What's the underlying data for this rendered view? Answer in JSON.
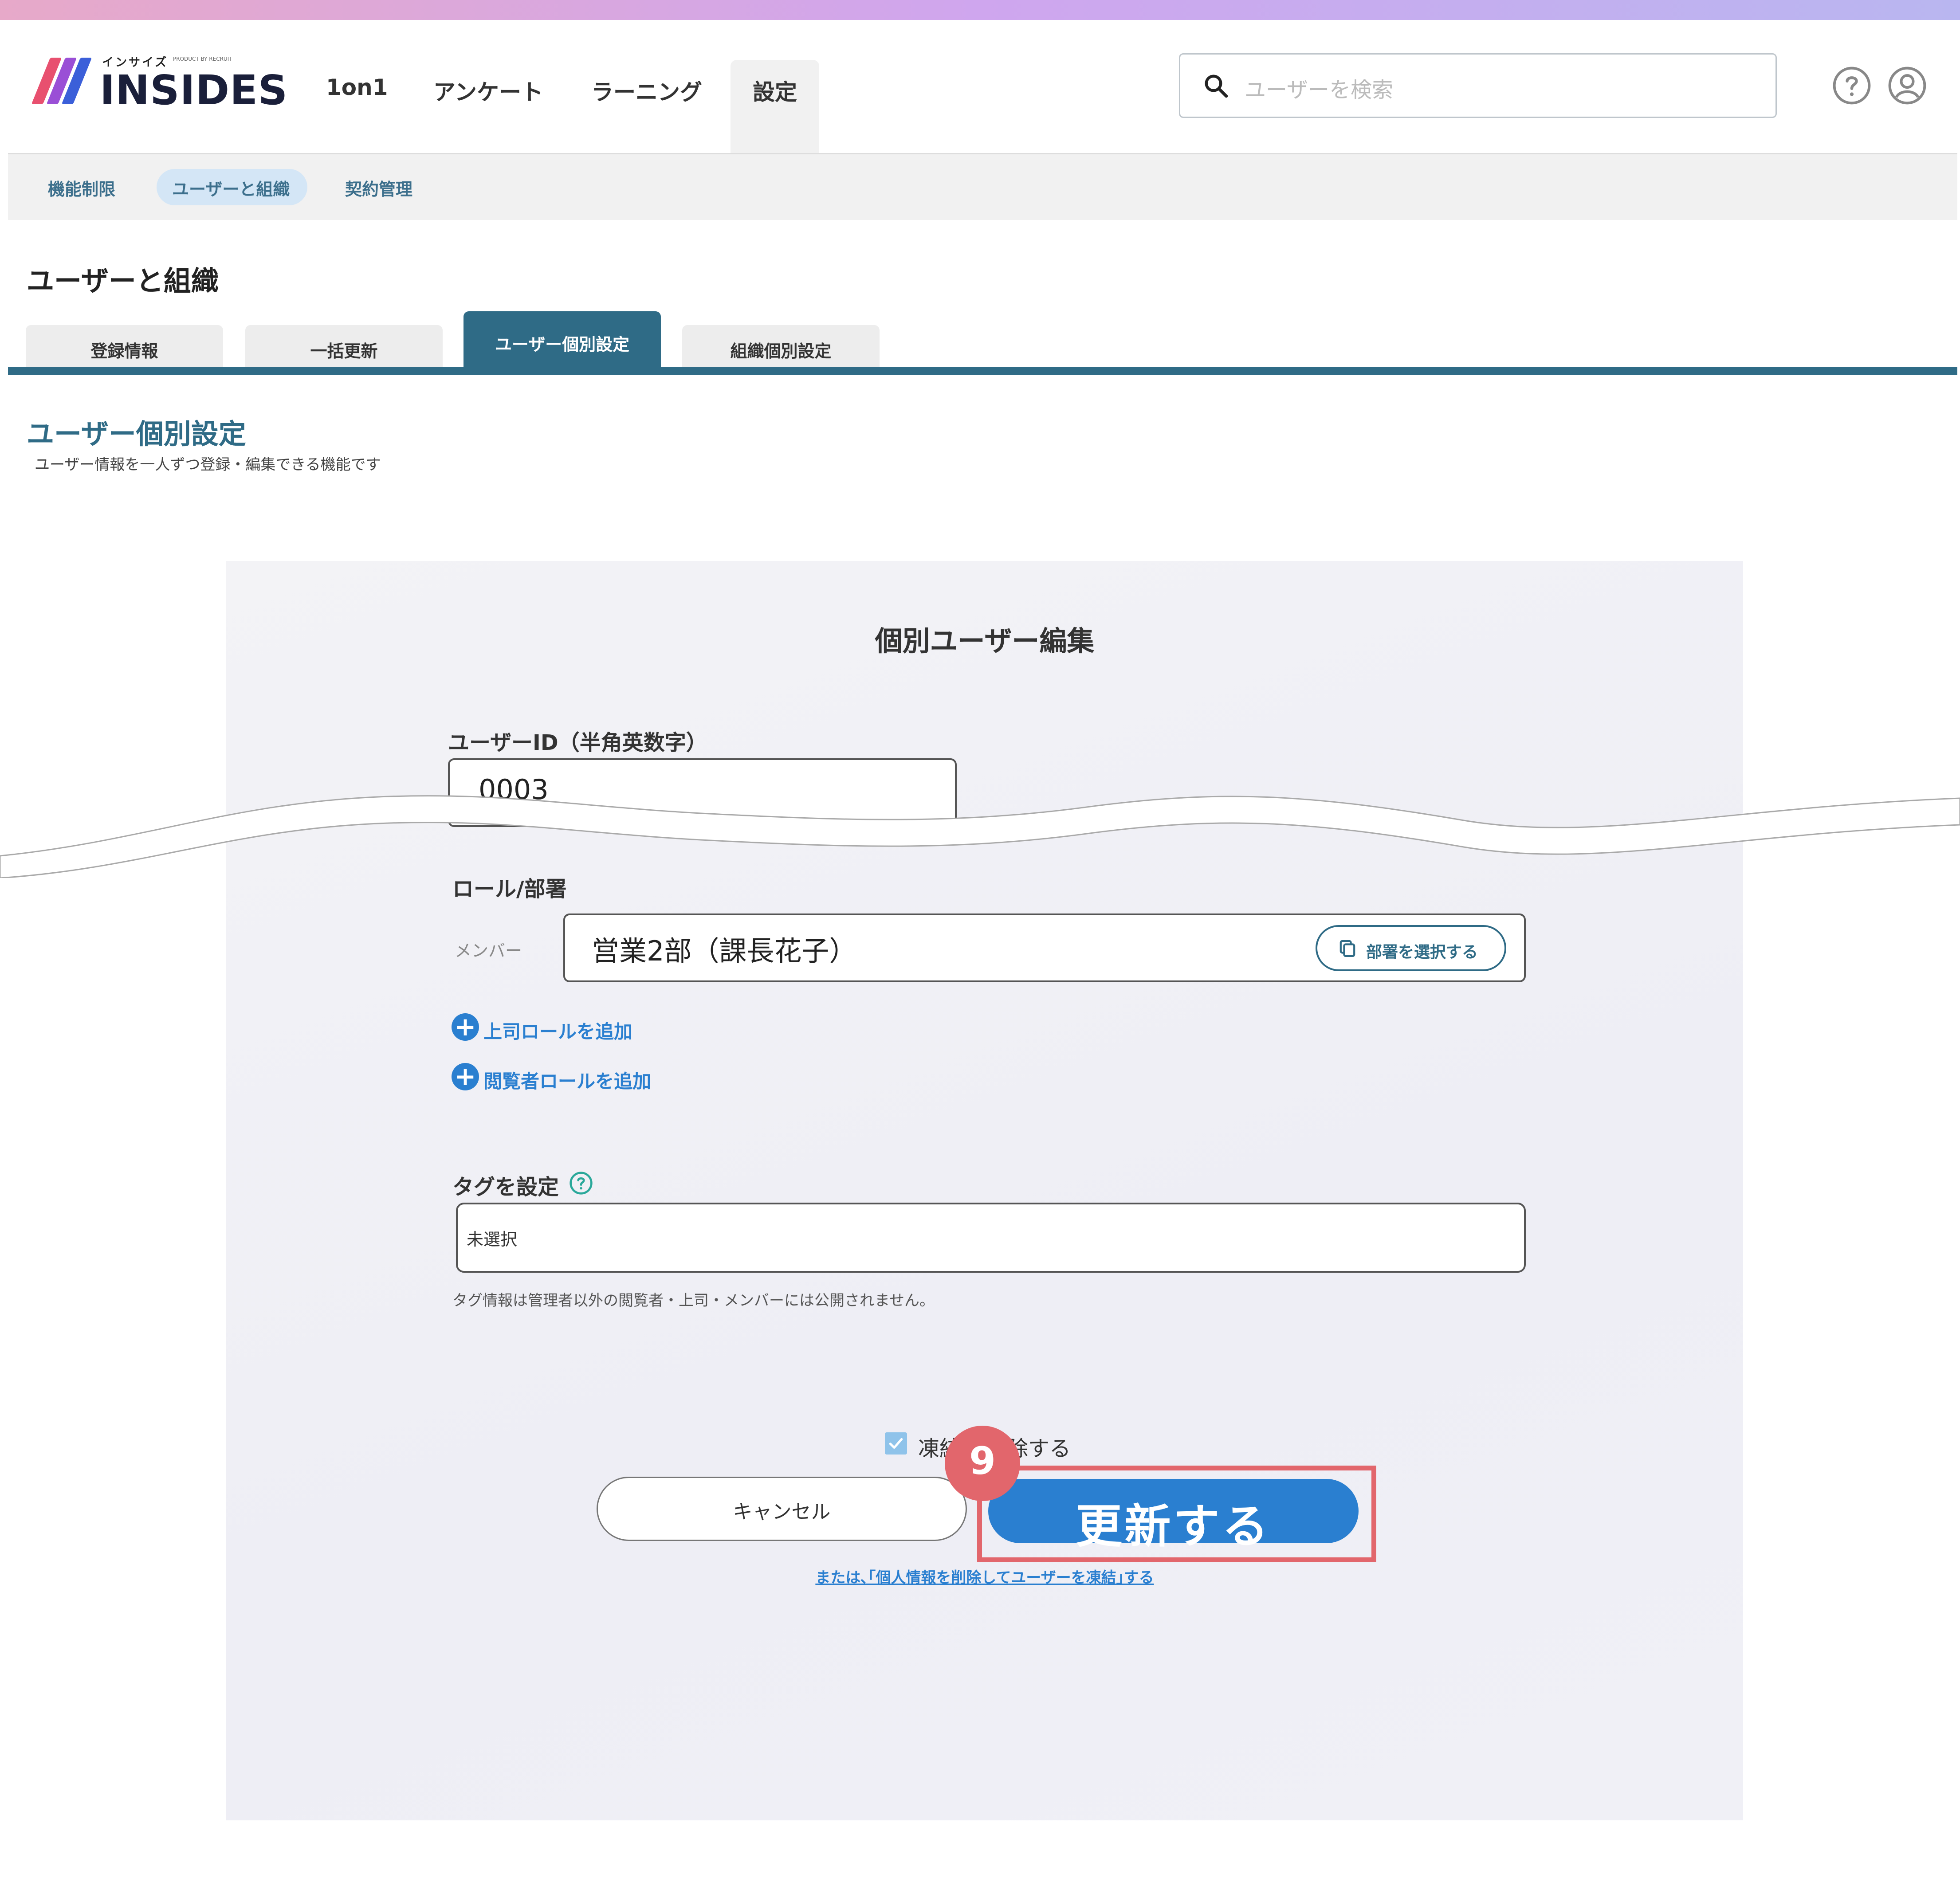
{
  "header": {
    "logo": {
      "kana": "インサイズ",
      "small": "PRODUCT BY RECRUIT",
      "word": "INSIDES"
    },
    "nav": [
      "1on1",
      "アンケート",
      "ラーニング",
      "設定"
    ],
    "search": {
      "placeholder": "ユーザーを検索"
    }
  },
  "subnav": [
    "機能制限",
    "ユーザーと組織",
    "契約管理"
  ],
  "section_title": "ユーザーと組織",
  "tabs": [
    "登録情報",
    "一括更新",
    "ユーザー個別設定",
    "組織個別設定"
  ],
  "page": {
    "heading": "ユーザー個別設定",
    "description": "ユーザー情報を一人ずつ登録・編集できる機能です"
  },
  "form": {
    "title": "個別ユーザー編集",
    "user_id_label": "ユーザーID（半角英数字）",
    "user_id_value": "0003",
    "role_label": "ロール/部署",
    "role_member_label": "メンバー",
    "role_value": "営業2部（課長花子）",
    "dept_button": "部署を選択する",
    "add_boss_role": "上司ロールを追加",
    "add_viewer_role": "閲覧者ロールを追加",
    "tag_label": "タグを設定",
    "tag_placeholder": "未選択",
    "tag_note": "タグ情報は管理者以外の閲覧者・上司・メンバーには公開されません。",
    "freeze_text_a": "凍結",
    "freeze_text_b": "除する",
    "freeze_checked": true,
    "cancel_button": "キャンセル",
    "update_button": "更新する",
    "freeze_link": "または､｢個人情報を削除してユーザーを凍結｣する"
  },
  "annotation": {
    "step": "9",
    "highlight_color": "#e2666c"
  },
  "colors": {
    "accent": "#2f6b86",
    "primary_button": "#2a7fd0"
  }
}
